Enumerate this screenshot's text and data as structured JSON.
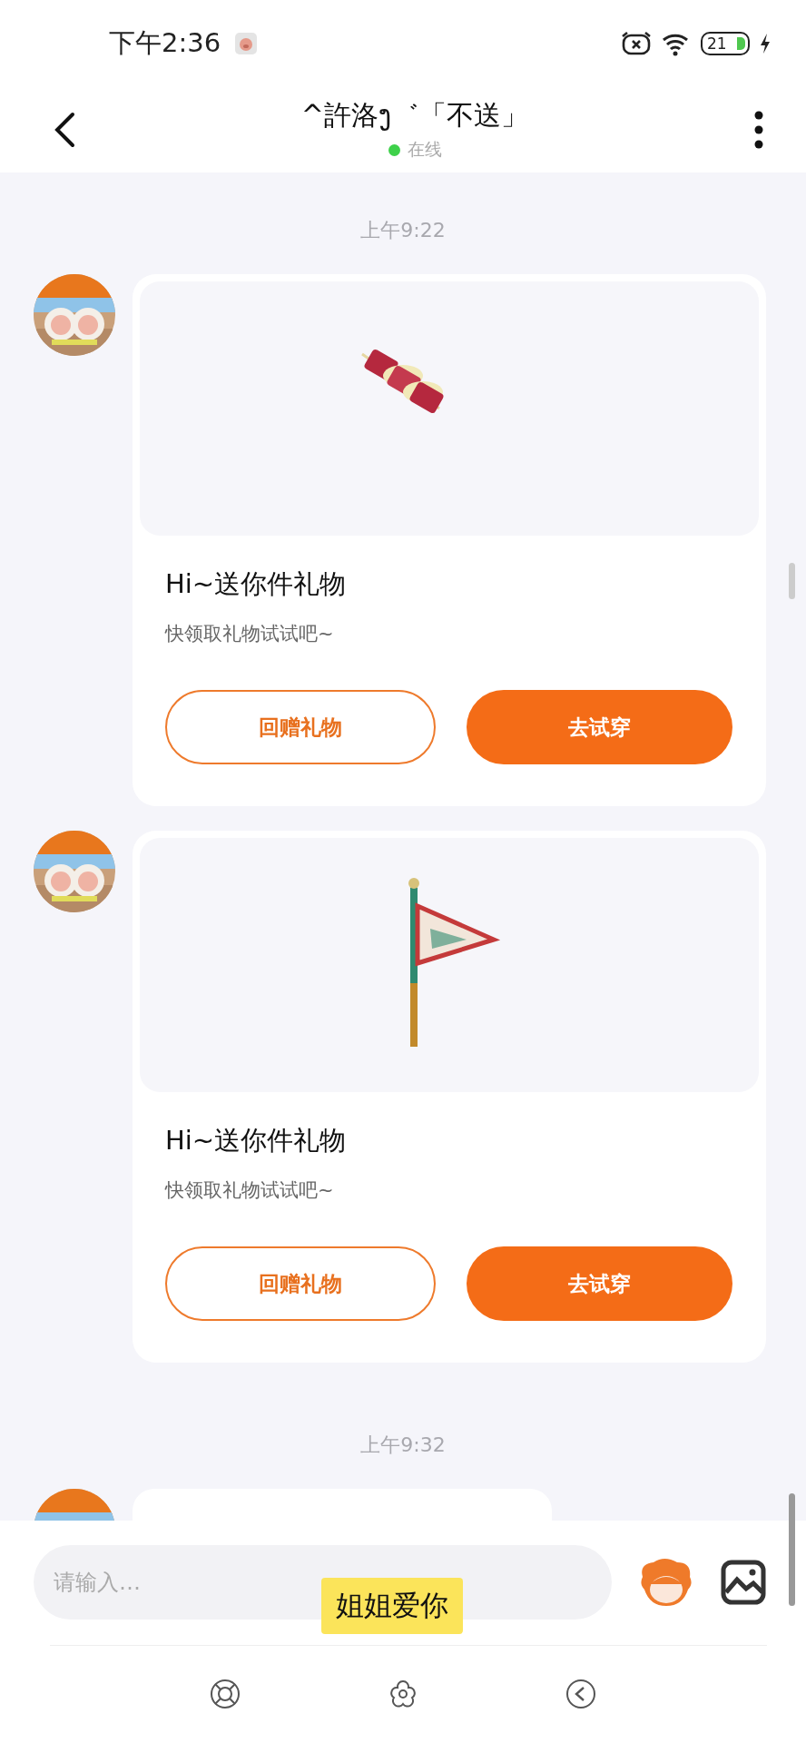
{
  "status_bar": {
    "time": "下午2:36",
    "battery": "21"
  },
  "header": {
    "title": "^許洛ງ゛「不送」",
    "presence": {
      "text": "在线",
      "online": true
    }
  },
  "messages": [
    {
      "kind": "timestamp",
      "text": "上午9:22"
    },
    {
      "kind": "gift",
      "title": "Hi~送你件礼物",
      "subtitle": "快领取礼物试试吧~",
      "buttons": [
        {
          "label": "回赠礼物",
          "primary": false
        },
        {
          "label": "去试穿",
          "primary": true
        }
      ]
    },
    {
      "kind": "gift",
      "title": "Hi~送你件礼物",
      "subtitle": "快领取礼物试试吧~",
      "buttons": [
        {
          "label": "回赠礼物",
          "primary": false
        },
        {
          "label": "去试穿",
          "primary": true
        }
      ]
    },
    {
      "kind": "timestamp",
      "text": "上午9:32"
    },
    {
      "kind": "cutoff"
    }
  ],
  "composer": {
    "placeholder": "请输入…"
  },
  "caption": "姐姐爱你"
}
